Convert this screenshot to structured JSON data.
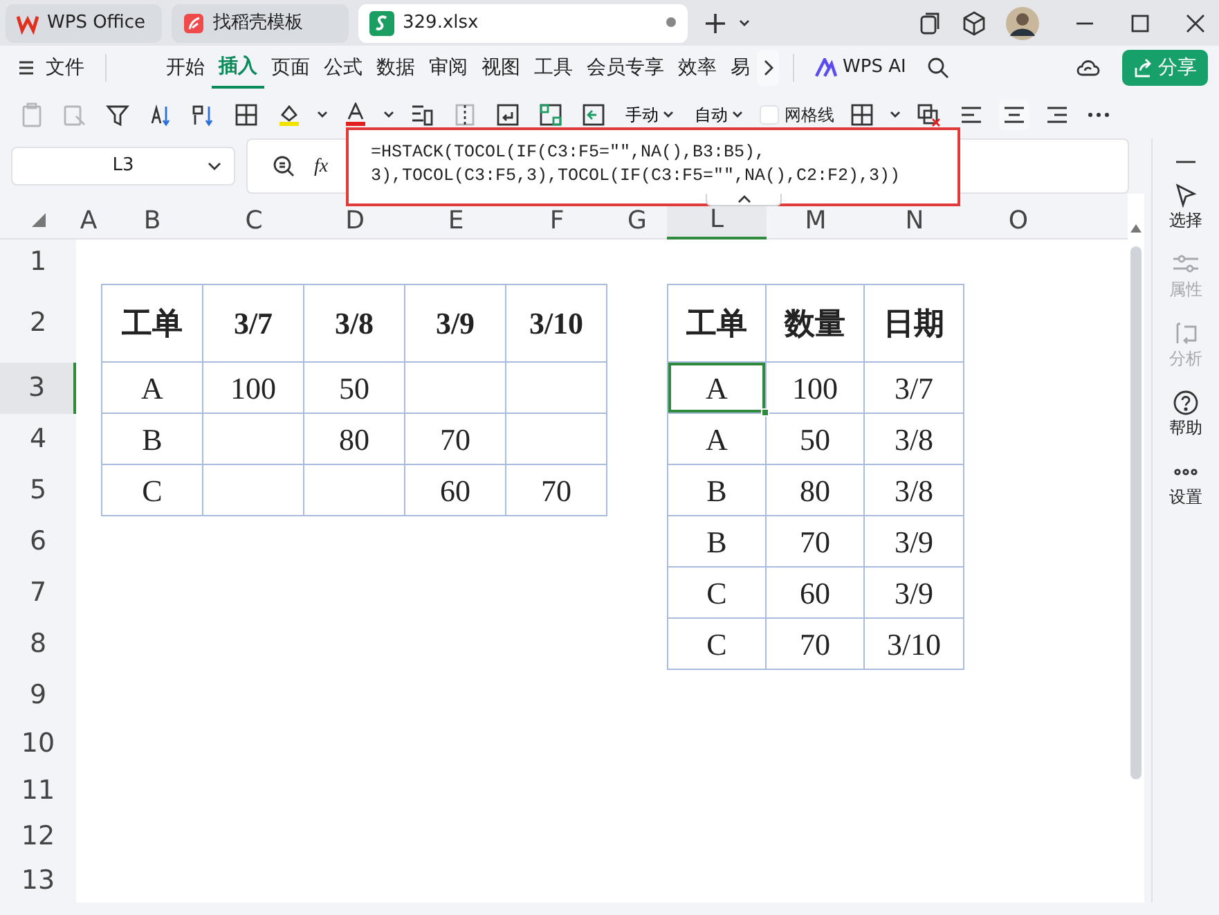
{
  "tabs": [
    {
      "label": "WPS Office",
      "kind": "app",
      "selected": false
    },
    {
      "label": "找稻壳模板",
      "kind": "template",
      "selected": false
    },
    {
      "label": "329.xlsx",
      "kind": "sheet",
      "selected": true,
      "modified": true
    }
  ],
  "menu": {
    "file": "文件",
    "tabs": [
      {
        "label": "开始",
        "selected": false
      },
      {
        "label": "插入",
        "selected": true
      },
      {
        "label": "页面",
        "selected": false
      },
      {
        "label": "公式",
        "selected": false
      },
      {
        "label": "数据",
        "selected": false
      },
      {
        "label": "审阅",
        "selected": false
      },
      {
        "label": "视图",
        "selected": false
      },
      {
        "label": "工具",
        "selected": false
      },
      {
        "label": "会员专享",
        "selected": false
      },
      {
        "label": "效率",
        "selected": false
      },
      {
        "label": "易",
        "selected": false
      }
    ],
    "ai": "WPS AI",
    "share": "分享"
  },
  "toolbar": {
    "dropdowns": [
      "手动",
      "自动"
    ],
    "gridlines": {
      "label": "网格线",
      "checked": false
    }
  },
  "formula_bar": {
    "name_box": "L3",
    "fx": "fx",
    "formula_lines": [
      "=HSTACK(TOCOL(IF(C3:F5=\"\",NA(),B3:B5),",
      "3),TOCOL(C3:F5,3),TOCOL(IF(C3:F5=\"\",NA(),C2:F2),3))"
    ]
  },
  "sheet": {
    "columns": [
      {
        "label": "A",
        "selected": false
      },
      {
        "label": "B",
        "selected": false
      },
      {
        "label": "C",
        "selected": false
      },
      {
        "label": "D",
        "selected": false
      },
      {
        "label": "E",
        "selected": false
      },
      {
        "label": "F",
        "selected": false
      },
      {
        "label": "G",
        "selected": false
      },
      {
        "label": "L",
        "selected": true
      },
      {
        "label": "M",
        "selected": false
      },
      {
        "label": "N",
        "selected": false
      },
      {
        "label": "O",
        "selected": false
      }
    ],
    "rows": [
      {
        "label": "1",
        "selected": false
      },
      {
        "label": "2",
        "selected": false
      },
      {
        "label": "3",
        "selected": true
      },
      {
        "label": "4",
        "selected": false
      },
      {
        "label": "5",
        "selected": false
      },
      {
        "label": "6",
        "selected": false
      },
      {
        "label": "7",
        "selected": false
      },
      {
        "label": "8",
        "selected": false
      },
      {
        "label": "9",
        "selected": false
      },
      {
        "label": "10",
        "selected": false
      },
      {
        "label": "11",
        "selected": false
      },
      {
        "label": "12",
        "selected": false
      },
      {
        "label": "13",
        "selected": false
      }
    ],
    "tables": [
      {
        "header": [
          {
            "text": "工单",
            "selected": false
          },
          {
            "text": "3/7",
            "selected": false
          },
          {
            "text": "3/8",
            "selected": false
          },
          {
            "text": "3/9",
            "selected": false
          },
          {
            "text": "3/10",
            "selected": false
          }
        ],
        "rows": [
          [
            {
              "text": "A",
              "selected": false
            },
            {
              "text": "100",
              "selected": false
            },
            {
              "text": "50",
              "selected": false
            },
            {
              "selected": false
            },
            {
              "selected": false
            }
          ],
          [
            {
              "text": "B",
              "selected": false
            },
            {
              "selected": false
            },
            {
              "text": "80",
              "selected": false
            },
            {
              "text": "70",
              "selected": false
            },
            {
              "selected": false
            }
          ],
          [
            {
              "text": "C",
              "selected": false
            },
            {
              "selected": false
            },
            {
              "selected": false
            },
            {
              "text": "60",
              "selected": false
            },
            {
              "text": "70",
              "selected": false
            }
          ]
        ]
      },
      {
        "header": [
          {
            "text": "工单",
            "selected": false
          },
          {
            "text": "数量",
            "selected": false
          },
          {
            "text": "日期",
            "selected": false
          }
        ],
        "rows": [
          [
            {
              "text": "A",
              "selected": true
            },
            {
              "text": "100",
              "selected": false
            },
            {
              "text": "3/7",
              "selected": false
            }
          ],
          [
            {
              "text": "A",
              "selected": false
            },
            {
              "text": "50",
              "selected": false
            },
            {
              "text": "3/8",
              "selected": false
            }
          ],
          [
            {
              "text": "B",
              "selected": false
            },
            {
              "text": "80",
              "selected": false
            },
            {
              "text": "3/8",
              "selected": false
            }
          ],
          [
            {
              "text": "B",
              "selected": false
            },
            {
              "text": "70",
              "selected": false
            },
            {
              "text": "3/9",
              "selected": false
            }
          ],
          [
            {
              "text": "C",
              "selected": false
            },
            {
              "text": "60",
              "selected": false
            },
            {
              "text": "3/9",
              "selected": false
            }
          ],
          [
            {
              "text": "C",
              "selected": false
            },
            {
              "text": "70",
              "selected": false
            },
            {
              "text": "3/10",
              "selected": false
            }
          ]
        ]
      }
    ]
  },
  "side_panel": [
    {
      "label": "选择",
      "disabled": false
    },
    {
      "label": "属性",
      "disabled": true
    },
    {
      "label": "分析",
      "disabled": true
    },
    {
      "label": "帮助",
      "disabled": false
    },
    {
      "label": "设置",
      "disabled": false
    }
  ]
}
